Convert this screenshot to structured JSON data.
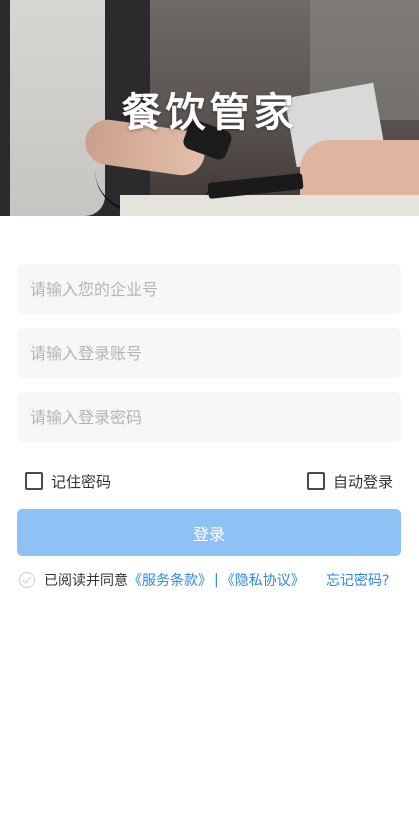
{
  "hero": {
    "title": "餐饮管家"
  },
  "form": {
    "company_placeholder": "请输入您的企业号",
    "account_placeholder": "请输入登录账号",
    "password_placeholder": "请输入登录密码"
  },
  "options": {
    "remember_label": "记住密码",
    "auto_login_label": "自动登录"
  },
  "login_button": "登录",
  "agreement": {
    "prefix": "已阅读并同意",
    "service_terms": "《服务条款》",
    "separator": "|",
    "privacy": "《隐私协议》"
  },
  "forgot_password": "忘记密码?",
  "colors": {
    "primary_disabled": "#8ec2f5",
    "link": "#2f86e8"
  }
}
